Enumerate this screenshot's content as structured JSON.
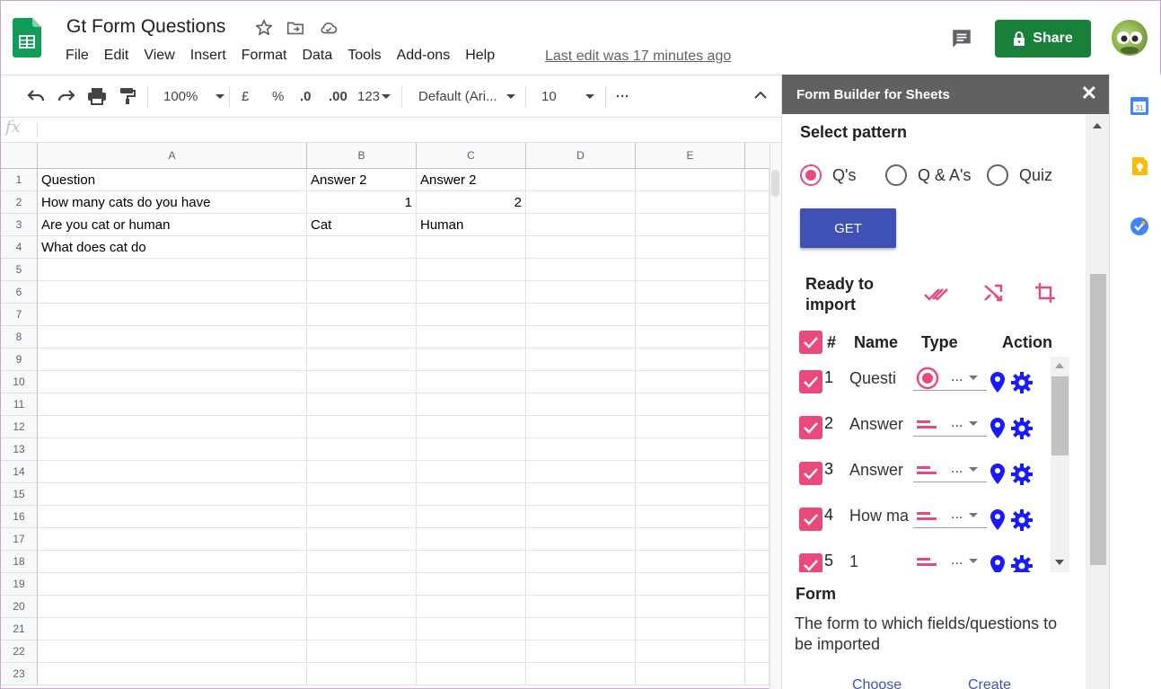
{
  "header": {
    "title": "Gt Form Questions",
    "menu": [
      "File",
      "Edit",
      "View",
      "Insert",
      "Format",
      "Data",
      "Tools",
      "Add-ons",
      "Help"
    ],
    "last_edit": "Last edit was 17 minutes ago",
    "share_label": "Share"
  },
  "toolbar": {
    "zoom": "100%",
    "currency": "£",
    "percent": "%",
    "decrease_decimal": ".0",
    "increase_decimal": ".00",
    "more_formats": "123",
    "font": "Default (Ari...",
    "font_size": "10",
    "more": "···"
  },
  "formula_bar": {
    "fx": "fx"
  },
  "sheet": {
    "columns": [
      "A",
      "B",
      "C",
      "D",
      "E"
    ],
    "rows": [
      "1",
      "2",
      "3",
      "4",
      "5",
      "6",
      "7",
      "8",
      "9",
      "10",
      "11",
      "12",
      "13",
      "14",
      "15",
      "16",
      "17",
      "18",
      "19",
      "20",
      "21",
      "22",
      "23"
    ],
    "cells": {
      "A1": "Question",
      "B1": "Answer 2",
      "C1": "Answer 2",
      "A2": "How many cats do you have",
      "B2": "1",
      "C2": "2",
      "A3": "Are you cat or human",
      "B3": "Cat",
      "C3": "Human",
      "A4": "What does cat do"
    }
  },
  "panel": {
    "title": "Form Builder for Sheets",
    "close": "✕",
    "select_pattern": "Select pattern",
    "patterns": [
      "Q's",
      "Q & A's",
      "Quiz"
    ],
    "selected_pattern": "Q's",
    "get_label": "GET",
    "ready_label_1": "Ready to",
    "ready_label_2": "import",
    "col_hash": "#",
    "col_name": "Name",
    "col_type": "Type",
    "col_action": "Action",
    "items": [
      {
        "num": "1",
        "name": "Questi",
        "type": "radio"
      },
      {
        "num": "2",
        "name": "Answer",
        "type": "text"
      },
      {
        "num": "3",
        "name": "Answer",
        "type": "text"
      },
      {
        "num": "4",
        "name": "How ma",
        "type": "text"
      },
      {
        "num": "5",
        "name": "1",
        "type": "text"
      }
    ],
    "type_placeholder": "...",
    "form_heading": "Form",
    "form_desc": "The form to which fields/questions to be imported",
    "choose_label": "Choose",
    "create_label": "Create"
  },
  "colors": {
    "share_green": "#188038",
    "accent_pink": "#e84a7b",
    "get_blue": "#3f51b5",
    "action_blue": "#1a1aff",
    "panel_header": "#616161"
  }
}
